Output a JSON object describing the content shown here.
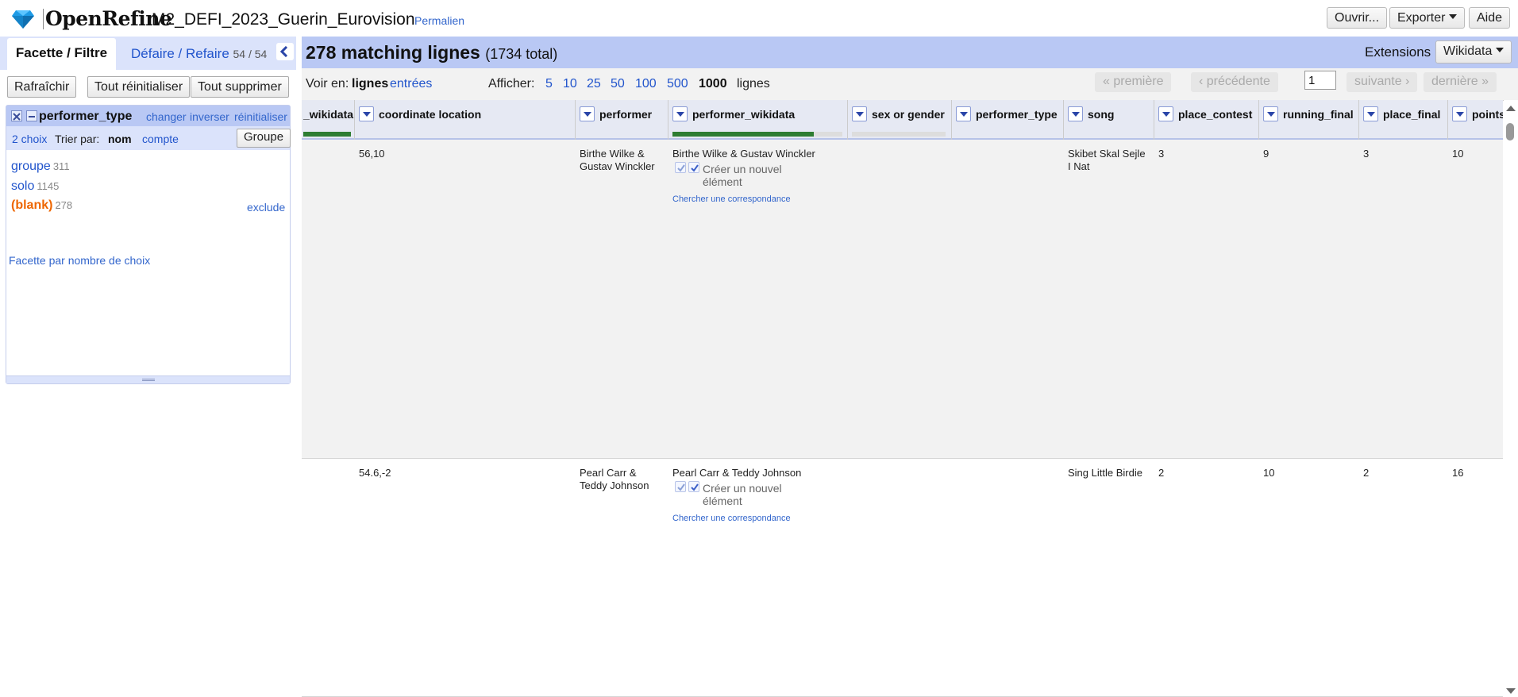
{
  "header": {
    "app_name": "OpenRefine",
    "project_name": "M2_DEFI_2023_Guerin_Eurovision",
    "permalink": "Permalien",
    "open_btn": "Ouvrir...",
    "export_btn": "Exporter",
    "help_btn": "Aide",
    "logo_icon": "diamond-icon"
  },
  "left_panel": {
    "tab_facet": "Facette / Filtre",
    "tab_undo": "Défaire / Refaire",
    "tab_undo_count": "54 / 54",
    "refresh_btn": "Rafraîchir",
    "reset_all_btn": "Tout réinitialiser",
    "remove_all_btn": "Tout supprimer",
    "facet": {
      "title": "performer_type",
      "change": "changer",
      "invert": "inverser",
      "reset": "réinitialiser",
      "choices_count": "2 choix",
      "sort_label": "Trier par:",
      "sort_name": "nom",
      "sort_count": "compte",
      "group_btn": "Groupe",
      "choices": [
        {
          "label": "groupe",
          "count": "311"
        },
        {
          "label": "solo",
          "count": "1145"
        },
        {
          "label": "(blank)",
          "count": "278"
        }
      ],
      "exclude": "exclude",
      "facet_by_count": "Facette par nombre de choix"
    }
  },
  "summary": {
    "matching": "278 matching lignes",
    "total": "(1734 total)",
    "extensions_label": "Extensions",
    "wikidata_btn": "Wikidata"
  },
  "view_bar": {
    "view_label": "Voir en:",
    "rows": "lignes",
    "records": "entrées",
    "show_label": "Afficher:",
    "page_sizes": [
      "5",
      "10",
      "25",
      "50",
      "100",
      "500"
    ],
    "current_size": "1000",
    "rows_suffix": "lignes",
    "first": "« première",
    "prev": "‹ précédente",
    "page": "1",
    "next": "suivante ›",
    "last": "dernière »"
  },
  "columns": [
    "_wikidata",
    "coordinate location",
    "performer",
    "performer_wikidata",
    "sex or gender",
    "performer_type",
    "song",
    "place_contest",
    "running_final",
    "place_final",
    "points"
  ],
  "reconciled_progress": {
    "first_column": 1.0,
    "performer_wikidata": 0.83,
    "sex_or_gender": 0.0
  },
  "rows": [
    {
      "coordinate": "56,10",
      "performer": "Birthe Wilke & Gustav Winckler",
      "performer_wikidata": "Birthe Wilke & Gustav Winckler",
      "create_new": "Créer un nouvel élément",
      "search_match": "Chercher une correspondance",
      "song": "Skibet Skal Sejle I Nat",
      "place_contest": "3",
      "running_final": "9",
      "place_final": "3",
      "points": "10"
    },
    {
      "coordinate": "54.6,-2",
      "performer": "Pearl Carr & Teddy Johnson",
      "performer_wikidata": "Pearl Carr & Teddy Johnson",
      "create_new": "Créer un nouvel élément",
      "search_match": "Chercher une correspondance",
      "song": "Sing Little Birdie",
      "place_contest": "2",
      "running_final": "10",
      "place_final": "2",
      "points": "16"
    }
  ],
  "colors": {
    "header_blue": "#b9c8f4",
    "link": "#2255cc",
    "blank_orange": "#ee6600",
    "recon_green": "#2e7d32"
  }
}
